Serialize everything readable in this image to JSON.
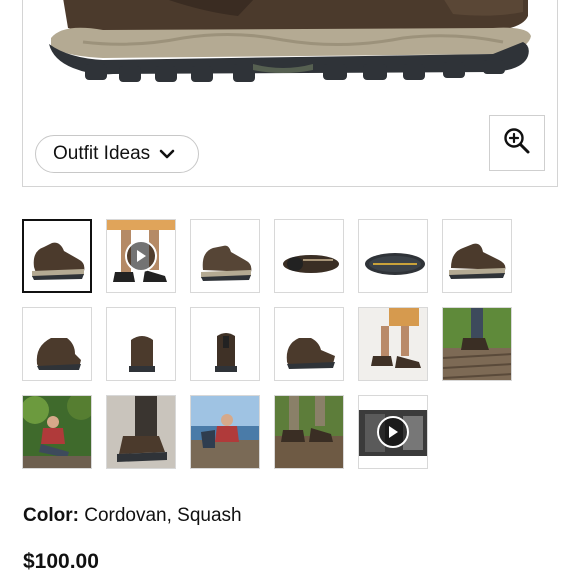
{
  "gallery": {
    "outfit_button_label": "Outfit Ideas",
    "zoom_icon": "zoom-in-icon",
    "thumbnails": [
      {
        "kind": "image",
        "name": "thumb-boot-side-left",
        "selected": true
      },
      {
        "kind": "video",
        "name": "thumb-video-legs-walking"
      },
      {
        "kind": "image",
        "name": "thumb-boot-side-right"
      },
      {
        "kind": "image",
        "name": "thumb-boot-top"
      },
      {
        "kind": "image",
        "name": "thumb-boot-sole"
      },
      {
        "kind": "image",
        "name": "thumb-boot-side-alt"
      },
      {
        "kind": "image",
        "name": "thumb-boot-angle"
      },
      {
        "kind": "image",
        "name": "thumb-boot-front"
      },
      {
        "kind": "image",
        "name": "thumb-boot-back"
      },
      {
        "kind": "image",
        "name": "thumb-boot-pair-angle"
      },
      {
        "kind": "image",
        "name": "thumb-lifestyle-legs-rocks"
      },
      {
        "kind": "image",
        "name": "thumb-lifestyle-boardwalk"
      },
      {
        "kind": "image",
        "name": "thumb-lifestyle-hiker-forest"
      },
      {
        "kind": "image",
        "name": "thumb-lifestyle-boot-closeup"
      },
      {
        "kind": "image",
        "name": "thumb-lifestyle-hiker-lake"
      },
      {
        "kind": "image",
        "name": "thumb-lifestyle-trail-mud"
      },
      {
        "kind": "video",
        "name": "thumb-video-2"
      }
    ]
  },
  "product": {
    "color_label": "Color:",
    "color_value": "Cordovan, Squash",
    "price": "$100.00"
  },
  "colors": {
    "boot_leather": "#4b3a2c",
    "boot_midsole": "#b4aa93",
    "outsole": "#2f3338",
    "border": "#d4d4d4",
    "selected_border": "#111111"
  }
}
